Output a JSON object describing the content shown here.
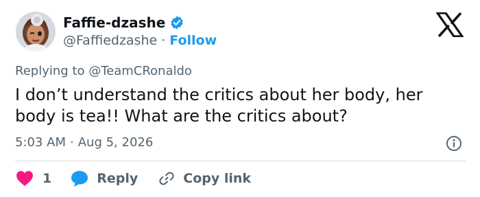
{
  "author": {
    "display_name": "Faffie-dzashe",
    "handle": "@Faffiedzashe",
    "separator": "·",
    "follow_label": "Follow",
    "avatar_icon": "memoji-avatar",
    "verified_icon": "verified-badge-icon"
  },
  "brand": {
    "logo_icon": "x-logo-icon"
  },
  "tweet": {
    "replying_to": "Replying to @TeamCRonaldo",
    "text": "I don’t understand the critics about her body, her body is tea!! What are the critics about?",
    "time": "5:03 AM",
    "separator": "·",
    "date": "Aug 5, 2026"
  },
  "actions": {
    "like_count": "1",
    "reply_label": "Reply",
    "copy_label": "Copy link"
  },
  "colors": {
    "accent": "#1d9bf0",
    "like": "#f91880",
    "text": "#0f1419",
    "muted": "#536471",
    "divider": "#cfd9de"
  }
}
